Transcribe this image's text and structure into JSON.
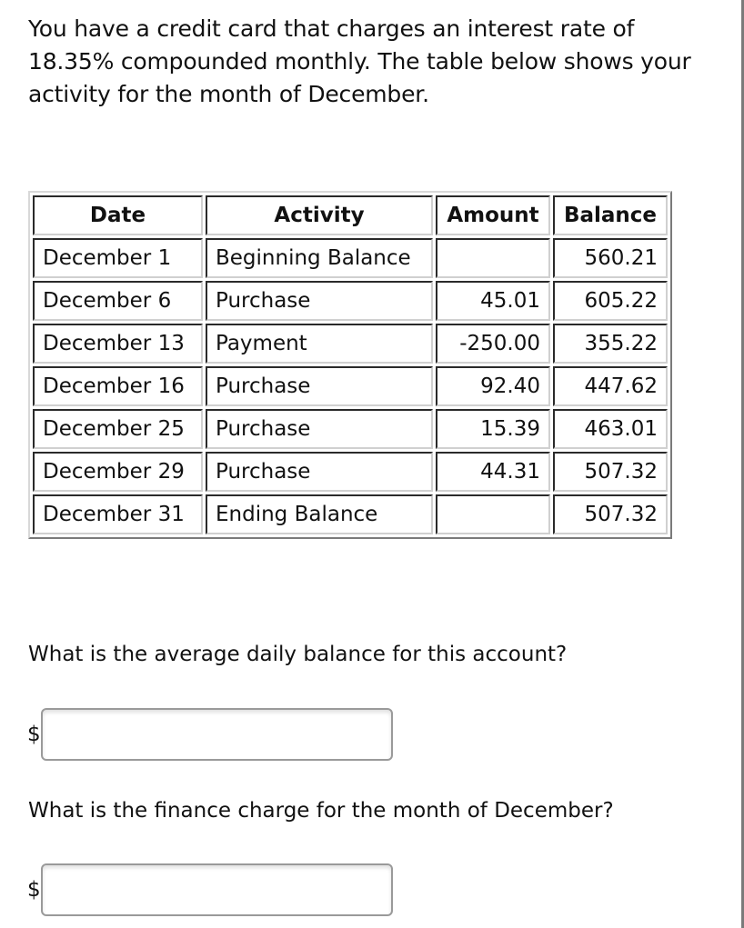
{
  "intro": "You have a credit card that charges an interest rate of 18.35% compounded monthly. The table below shows your activity for the month of December.",
  "table": {
    "headers": {
      "date": "Date",
      "activity": "Activity",
      "amount": "Amount",
      "balance": "Balance"
    },
    "rows": [
      {
        "date": "December 1",
        "activity": "Beginning Balance",
        "amount": "",
        "balance": "560.21"
      },
      {
        "date": "December 6",
        "activity": "Purchase",
        "amount": "45.01",
        "balance": "605.22"
      },
      {
        "date": "December 13",
        "activity": "Payment",
        "amount": "-250.00",
        "balance": "355.22"
      },
      {
        "date": "December 16",
        "activity": "Purchase",
        "amount": "92.40",
        "balance": "447.62"
      },
      {
        "date": "December 25",
        "activity": "Purchase",
        "amount": "15.39",
        "balance": "463.01"
      },
      {
        "date": "December 29",
        "activity": "Purchase",
        "amount": "44.31",
        "balance": "507.32"
      },
      {
        "date": "December 31",
        "activity": "Ending Balance",
        "amount": "",
        "balance": "507.32"
      }
    ]
  },
  "questions": [
    {
      "prompt": "What is the average daily balance for this account?",
      "prefix": "$",
      "value": ""
    },
    {
      "prompt": "What is the finance charge for the month of December?",
      "prefix": "$",
      "value": ""
    }
  ]
}
